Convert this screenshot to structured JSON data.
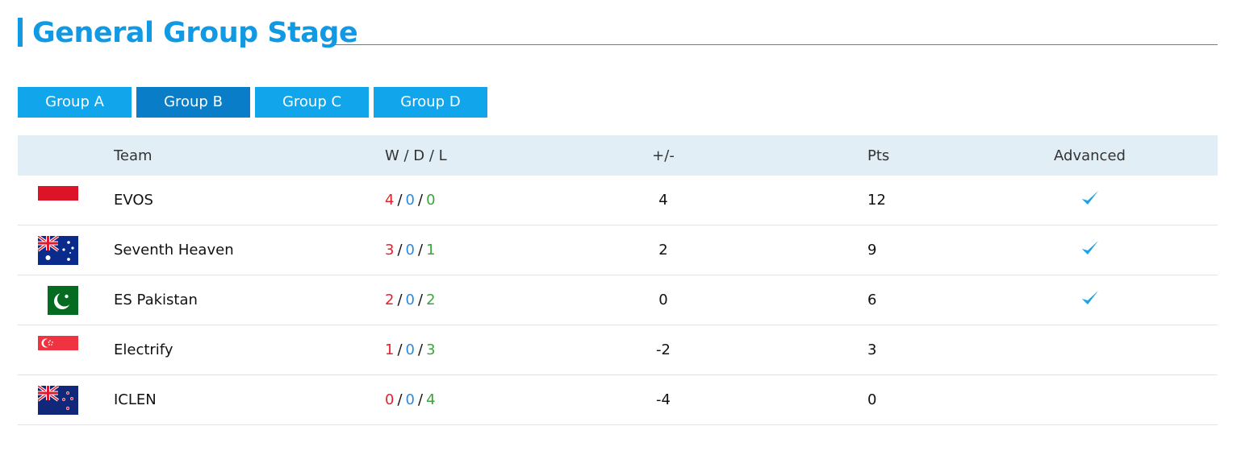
{
  "page": {
    "title": "General Group Stage",
    "accent": "#1199e3",
    "tab_color": "#11a5ec",
    "tab_active_color": "#0a7dc8",
    "header_bg": "#e2eef6"
  },
  "tabs": [
    {
      "label": "Group A",
      "active": false
    },
    {
      "label": "Group B",
      "active": true
    },
    {
      "label": "Group C",
      "active": false
    },
    {
      "label": "Group D",
      "active": false
    }
  ],
  "table": {
    "headers": {
      "team": "Team",
      "wdl": "W / D / L",
      "gd": "+/-",
      "pts": "Pts",
      "advanced": "Advanced"
    },
    "wdl_sep": "/",
    "colors": {
      "win": "#e8202a",
      "draw": "#2a8be0",
      "loss": "#3aa53a",
      "check": "#1aa3ea"
    },
    "rows": [
      {
        "flag": "indonesia-flag",
        "team": "EVOS",
        "w": "4",
        "d": "0",
        "l": "0",
        "gd": "4",
        "pts": "12",
        "advanced": true
      },
      {
        "flag": "australia-flag",
        "team": "Seventh Heaven",
        "w": "3",
        "d": "0",
        "l": "1",
        "gd": "2",
        "pts": "9",
        "advanced": true
      },
      {
        "flag": "pakistan-flag",
        "team": "ES Pakistan",
        "w": "2",
        "d": "0",
        "l": "2",
        "gd": "0",
        "pts": "6",
        "advanced": true
      },
      {
        "flag": "singapore-flag",
        "team": "Electrify",
        "w": "1",
        "d": "0",
        "l": "3",
        "gd": "-2",
        "pts": "3",
        "advanced": false
      },
      {
        "flag": "new-zealand-flag",
        "team": "ICLEN",
        "w": "0",
        "d": "0",
        "l": "4",
        "gd": "-4",
        "pts": "0",
        "advanced": false
      }
    ]
  }
}
